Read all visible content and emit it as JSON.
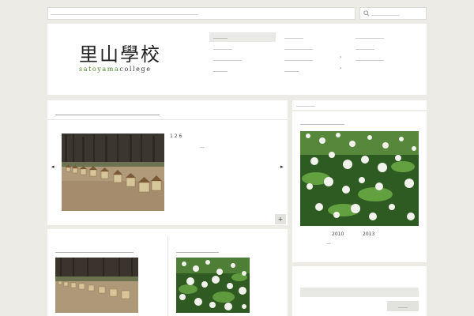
{
  "ticker": {
    "text": "＿＿＿＿＿＿＿＿＿＿＿＿＿＿＿＿＿＿＿＿＿＿＿＿＿＿＿＿＿＿＿"
  },
  "search": {
    "placeholder": "＿＿＿＿＿＿"
  },
  "logo": {
    "kanji": "里山學校",
    "sub_green": "satoyama",
    "sub_gray": "college"
  },
  "nav": {
    "col1": [
      "＿＿＿",
      "＿＿＿＿",
      "＿＿＿＿＿＿",
      "＿＿＿"
    ],
    "col2": [
      "＿＿＿＿",
      "＿＿＿＿＿＿",
      "＿＿＿＿＿＿",
      "＿＿＿"
    ],
    "col3": [
      "＿＿＿＿＿＿",
      "＿＿＿＿",
      "＿＿＿＿＿＿"
    ],
    "arrow": "›"
  },
  "news": {
    "title": "＿＿＿＿＿＿＿＿＿＿＿＿",
    "date": "1 2 6",
    "ellipsis": "...",
    "prev": "◂",
    "next": "▸",
    "more": "+"
  },
  "bottom": {
    "left_title": "＿＿＿＿＿＿＿＿＿＿＿",
    "right_title": "＿＿＿＿＿＿"
  },
  "side": {
    "head": "＿＿＿＿",
    "title": "＿＿＿＿＿＿＿",
    "year_from": "2010",
    "year_to": "2013",
    "ellipsis": "..."
  },
  "side2": {
    "button": "＿＿"
  },
  "colors": {
    "background": "#ecebe6",
    "panel": "#ffffff",
    "brand_green": "#4a8a2a",
    "button": "#e2e2de"
  }
}
